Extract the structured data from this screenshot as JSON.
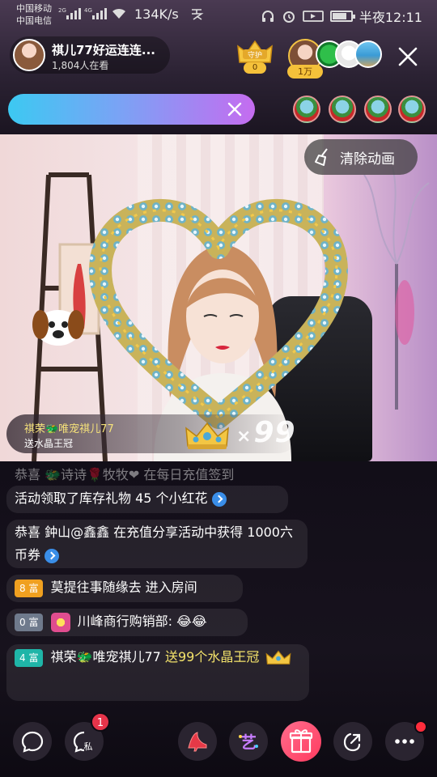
{
  "status_bar": {
    "carrier_1": "中国移动",
    "carrier_2": "中国电信",
    "net_1": "2G",
    "net_2": "4G",
    "speed": "134K/s",
    "time": "半夜12:11"
  },
  "header": {
    "host_name": "祺儿77好运连连...",
    "viewers": "1,804人在看",
    "guard_count": "0",
    "top_fan_value": "1万"
  },
  "search": {
    "value": "",
    "placeholder": ""
  },
  "stream": {
    "clear_animation_label": "清除动画",
    "gift_banner": {
      "sender": "祺荣🐲唯宠祺儿77",
      "gift": "送水晶王冠",
      "count_prefix": "×",
      "count": "99"
    }
  },
  "chat": {
    "msg0": "恭喜 🐲诗诗🌹牧牧❤ 在每日充值签到",
    "msg1_text": "活动领取了库存礼物 45 个小红花",
    "msg2_text": "恭喜 鈡山@鑫鑫 在充值分享活动中获得 1000六币券",
    "msg3": {
      "level": "8",
      "level_label": "富",
      "text": "莫提往事随缘去 进入房间"
    },
    "msg4": {
      "level": "0",
      "level_label": "富",
      "name": "川峰商行购销部:",
      "text": "😂😂"
    },
    "msg5": {
      "level": "4",
      "level_label": "富",
      "name": "祺荣🐲唯宠祺儿77",
      "text": "送99个水晶王冠"
    }
  },
  "toolbar": {
    "private_unread": "1",
    "private_label": "私"
  },
  "colors": {
    "accent_pink": "#ff3b5f",
    "gold": "#f5c13a",
    "level_8": "#f0a020",
    "level_0": "#6f7a8c",
    "level_4": "#1fb5a8"
  }
}
